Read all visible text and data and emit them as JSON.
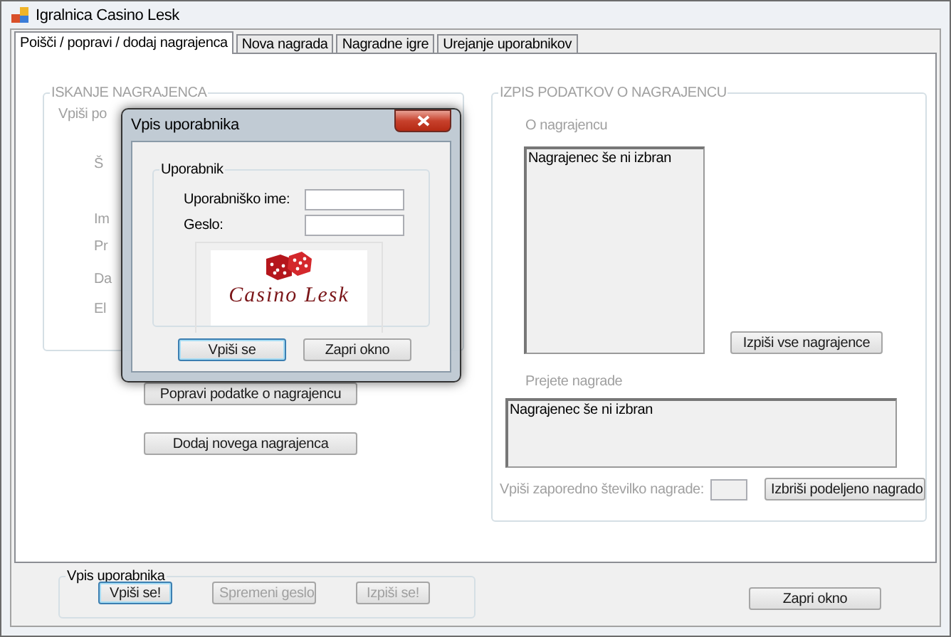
{
  "window": {
    "title": "Igralnica Casino Lesk"
  },
  "tabs": [
    {
      "label": "Poišči / popravi / dodaj nagrajenca",
      "selected": true
    },
    {
      "label": "Nova nagrada",
      "selected": false
    },
    {
      "label": "Nagradne igre",
      "selected": false
    },
    {
      "label": "Urejanje uporabnikov",
      "selected": false
    }
  ],
  "search_group": {
    "title": "ISKANJE NAGRAJENCA",
    "disabled": true,
    "labels": [
      "Vpiši po",
      "Š",
      "Im",
      "Pr",
      "Da",
      "El"
    ]
  },
  "tab_buttons": [
    "Popravi podatke o nagrajencu",
    "Dodaj novega nagrajenca"
  ],
  "details_group": {
    "title": "IZPIS PODATKOV O NAGRAJENCU",
    "disabled": true,
    "about_label": "O nagrajencu",
    "about_text": "Nagrajenec še ni izbran",
    "list_all_button": "Izpiši vse nagrajence",
    "prizes_label": "Prejete nagrade",
    "prizes_text": "Nagrajenec še ni izbran",
    "number_label": "Vpiši zaporedno številko nagrade:",
    "delete_button": "Izbriši podeljeno nagrado"
  },
  "login_bar": {
    "title": "Vpis uporabnika",
    "buttons": [
      {
        "label": "Vpiši se!",
        "disabled": false,
        "focused": true
      },
      {
        "label": "Spremeni geslo",
        "disabled": true,
        "focused": false
      },
      {
        "label": "Izpiši se!",
        "disabled": true,
        "focused": false
      }
    ]
  },
  "close_button": "Zapri okno",
  "dialog": {
    "title": "Vpis uporabnika",
    "group": "Uporabnik",
    "fields": [
      {
        "label": "Uporabniško ime:"
      },
      {
        "label": "Geslo:"
      }
    ],
    "logo_text": "Casino Lesk",
    "buttons": [
      {
        "label": "Vpiši se",
        "focused": true
      },
      {
        "label": "Zapri okno",
        "focused": false
      }
    ]
  }
}
